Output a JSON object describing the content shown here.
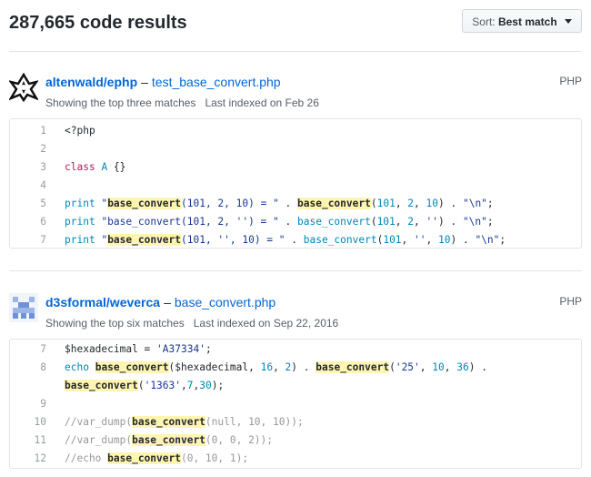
{
  "header": {
    "results_count": "287,665 code results",
    "sort_label": "Sort:",
    "sort_value": "Best match"
  },
  "results": [
    {
      "repo": "altenwald/ephp",
      "dash": "–",
      "file": "test_base_convert.php",
      "language": "PHP",
      "matches_text": "Showing the top three matches",
      "indexed_text": "Last indexed on Feb 26",
      "avatar_icon": "black-geometric-avatar-icon",
      "lines": [
        {
          "n": "1"
        },
        {
          "n": "2"
        },
        {
          "n": "3"
        },
        {
          "n": "5"
        },
        {
          "n": "6"
        },
        {
          "n": "7"
        }
      ]
    },
    {
      "repo": "d3sformal/weverca",
      "dash": "–",
      "file": "base_convert.php",
      "language": "PHP",
      "matches_text": "Showing the top six matches",
      "indexed_text": "Last indexed on Sep 22, 2016",
      "avatar_icon": "blue-pixel-identicon",
      "lines": [
        {
          "n": "7"
        },
        {
          "n": "8"
        },
        {
          "n": ""
        },
        {
          "n": "9"
        },
        {
          "n": "10"
        },
        {
          "n": "11"
        },
        {
          "n": "12"
        }
      ]
    }
  ],
  "colors": {
    "link": "#0366d6",
    "highlight": "#fff5b1",
    "keyword": "#a71d5d",
    "builtin": "#0086b3",
    "string": "#183691",
    "comment": "#969896"
  }
}
